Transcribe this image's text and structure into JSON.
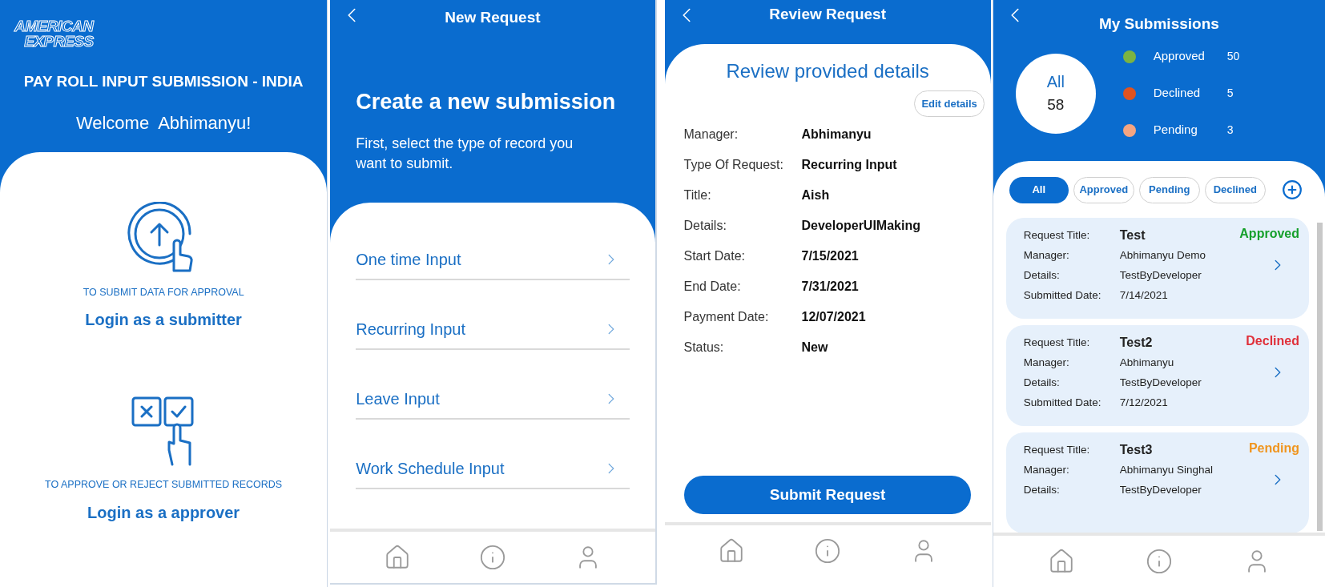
{
  "welcome_screen": {
    "logo": [
      "AMERICAN",
      "EXPRESS"
    ],
    "title": "PAY ROLL INPUT SUBMISSION - INDIA",
    "greeting": "Welcome  Abhimanyu!",
    "options": [
      {
        "kind": "submit",
        "caption": "TO SUBMIT DATA FOR APPROVAL",
        "link": "Login as a submitter"
      },
      {
        "kind": "approve",
        "caption": "TO APPROVE OR REJECT SUBMITTED RECORDS",
        "link": "Login as a approver"
      }
    ]
  },
  "new_request_screen": {
    "title": "New Request",
    "heading": "Create a new submission",
    "subtitle": "First, select the type of record you want to submit.",
    "items": [
      "One time Input",
      "Recurring Input",
      "Leave Input",
      "Work Schedule Input"
    ]
  },
  "review_screen": {
    "title": "Review Request",
    "heading": "Review provided details",
    "edit_button": "Edit details",
    "fields": [
      {
        "label": "Manager:",
        "value": "Abhimanyu"
      },
      {
        "label": "Type Of Request:",
        "value": "Recurring Input"
      },
      {
        "label": "Title:",
        "value": "Aish"
      },
      {
        "label": "Details:",
        "value": "DeveloperUIMaking"
      },
      {
        "label": "Start Date:",
        "value": "7/15/2021"
      },
      {
        "label": "End Date:",
        "value": "7/31/2021"
      },
      {
        "label": "Payment Date:",
        "value": "12/07/2021"
      },
      {
        "label": "Status:",
        "value": "New"
      }
    ],
    "submit_button": "Submit Request"
  },
  "submissions_screen": {
    "title": "My Submissions",
    "total": {
      "label": "All",
      "count": "58"
    },
    "legend": [
      {
        "label": "Approved",
        "count": "50",
        "color": "#7cb342"
      },
      {
        "label": "Declined",
        "count": "5",
        "color": "#e0531f"
      },
      {
        "label": "Pending",
        "count": "3",
        "color": "#f4a582"
      }
    ],
    "filters": [
      {
        "label": "All",
        "selected": true
      },
      {
        "label": "Approved",
        "selected": false
      },
      {
        "label": "Pending",
        "selected": false
      },
      {
        "label": "Declined",
        "selected": false
      }
    ],
    "cards": [
      {
        "status": "Approved",
        "color": "#16a02b",
        "rows": [
          {
            "label": "Request Title:",
            "value": "Test"
          },
          {
            "label": "Manager:",
            "value": "Abhimanyu Demo"
          },
          {
            "label": "Details:",
            "value": "TestByDeveloper"
          },
          {
            "label": "Submitted Date:",
            "value": "7/14/2021"
          }
        ]
      },
      {
        "status": "Declined",
        "color": "#e0303a",
        "rows": [
          {
            "label": "Request Title:",
            "value": "Test2"
          },
          {
            "label": "Manager:",
            "value": "Abhimanyu"
          },
          {
            "label": "Details:",
            "value": "TestByDeveloper"
          },
          {
            "label": "Submitted Date:",
            "value": "7/12/2021"
          }
        ]
      },
      {
        "status": "Pending",
        "color": "#f0951e",
        "rows": [
          {
            "label": "Request Title:",
            "value": "Test3"
          },
          {
            "label": "Manager:",
            "value": "Abhimanyu Singhal"
          },
          {
            "label": "Details:",
            "value": "TestByDeveloper"
          }
        ]
      }
    ]
  }
}
